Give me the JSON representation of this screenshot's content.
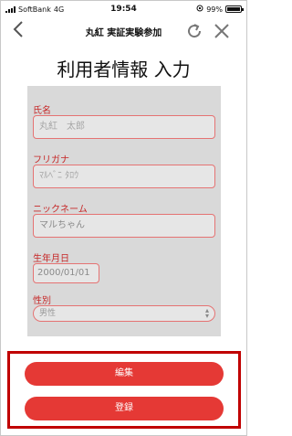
{
  "status_bar": {
    "carrier": "SoftBank",
    "network": "4G",
    "time": "19:54",
    "battery": "99%",
    "battery_level": 0.99
  },
  "nav": {
    "title": "丸紅 実証実験参加",
    "back_icon": "chevron-left-icon",
    "reload_icon": "reload-icon",
    "close_icon": "close-icon"
  },
  "page_title": "利用者情報 入力",
  "form": {
    "name": {
      "label": "氏名",
      "value": "丸紅　太郎"
    },
    "kana": {
      "label": "フリガナ",
      "value": "ﾏﾙﾍﾞﾆ ﾀﾛｳ"
    },
    "nickname": {
      "label": "ニックネーム",
      "value": "マルちゃん"
    },
    "birthdate": {
      "label": "生年月日",
      "value": "2000/01/01"
    },
    "gender": {
      "label": "性別",
      "value": "男性"
    }
  },
  "buttons": {
    "edit": "編集",
    "register": "登録"
  },
  "colors": {
    "accent": "#e53935",
    "label": "#c62828",
    "highlight_border": "#c00000",
    "form_bg": "#d9d9d9"
  }
}
